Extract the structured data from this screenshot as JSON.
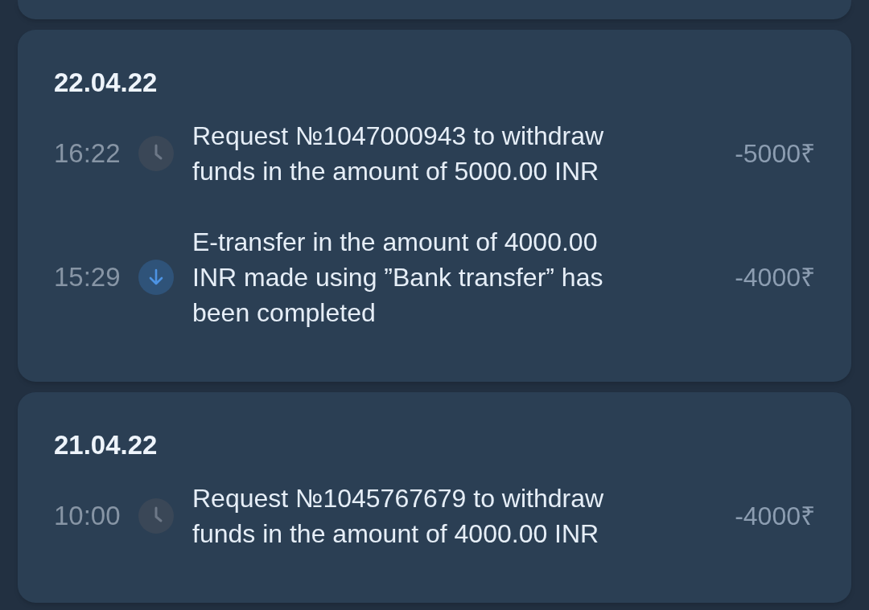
{
  "groups": [
    {
      "date": "22.04.22",
      "transactions": [
        {
          "time": "16:22",
          "kind": "request",
          "description": "Request №1047000943 to withdraw funds in the amount of 5000.00 INR",
          "amount": "-5000₹"
        },
        {
          "time": "15:29",
          "kind": "transfer",
          "description": "E-transfer in the amount of 4000.00 INR made using ”Bank transfer” has been completed",
          "amount": "-4000₹"
        }
      ]
    },
    {
      "date": "21.04.22",
      "transactions": [
        {
          "time": "10:00",
          "kind": "request",
          "description": "Request №1045767679 to withdraw funds in the amount of 4000.00 INR",
          "amount": "-4000₹"
        }
      ]
    }
  ]
}
